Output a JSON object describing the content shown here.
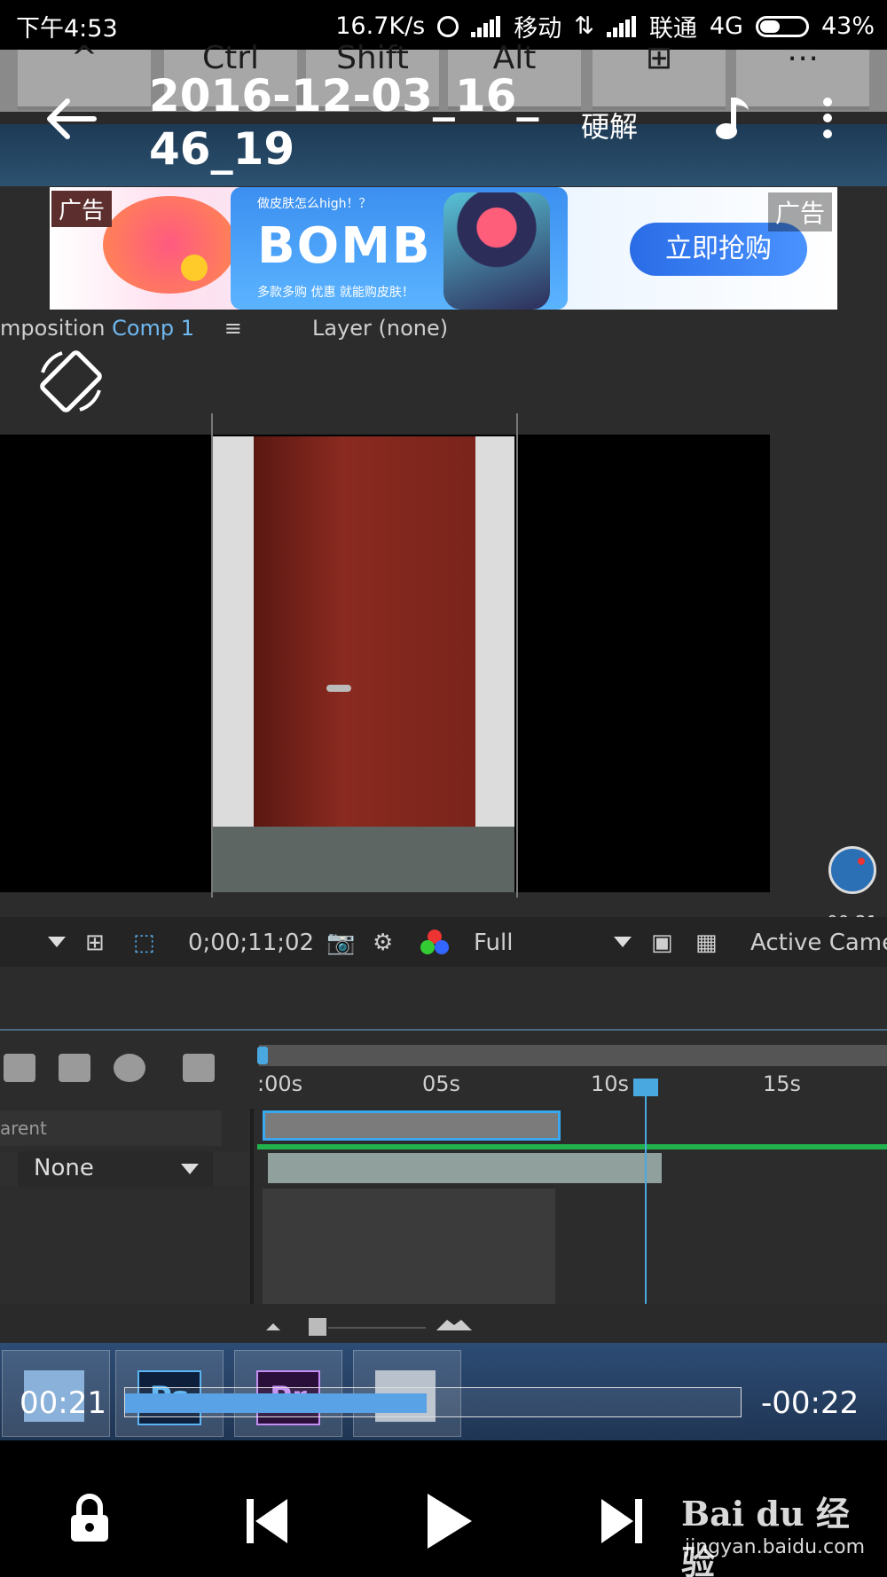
{
  "status": {
    "time": "下午4:53",
    "speed": "16.7K/s",
    "carrier1": "移动",
    "carrier2": "联通",
    "network": "4G",
    "battery": "43%"
  },
  "desktop": {
    "keys": [
      "^",
      "Ctrl",
      "Shift",
      "Alt",
      "⊞",
      "⋯"
    ],
    "ae": {
      "comp_tab_prefix": "mposition",
      "comp_tab_name": "Comp 1",
      "layer_tab": "Layer (none)",
      "timecode": "0;00;11;02",
      "resolution": "Full",
      "view": "Active Camera",
      "rec_time": "00:21",
      "ruler_ticks": [
        ":00s",
        "05s",
        "10s",
        "15s"
      ],
      "parent_label": "arent",
      "parent_value": "None"
    },
    "taskbar_apps": [
      "",
      "Ps",
      "Pr",
      ""
    ]
  },
  "player": {
    "title": "2016-12-03_16_46_19",
    "hw_decode": "硬解",
    "ad_tag": "广告",
    "ad_tag_right": "广告",
    "ad_small": "做皮肤怎么high！？",
    "ad_brand": "BOMB",
    "ad_sub": "多款多购 优惠 就能购皮肤！",
    "ad_cta": "立即抢购",
    "current_time": "00:21",
    "remaining_time": "-00:22",
    "progress_pct": 49
  },
  "watermark": {
    "main": "Bai du 经验",
    "sub": "jingyan.baidu.com"
  },
  "colors": {
    "accent": "#5aa2e6",
    "ae_blue": "#3aa7ef",
    "ae_green": "#22b24c"
  },
  "icons": {
    "back": "arrow-left-icon",
    "music": "music-note-icon",
    "more": "more-vert-icon",
    "rotate": "screen-rotate-icon",
    "lock": "lock-icon",
    "prev": "skip-previous-icon",
    "play": "play-icon",
    "next": "skip-next-icon"
  }
}
